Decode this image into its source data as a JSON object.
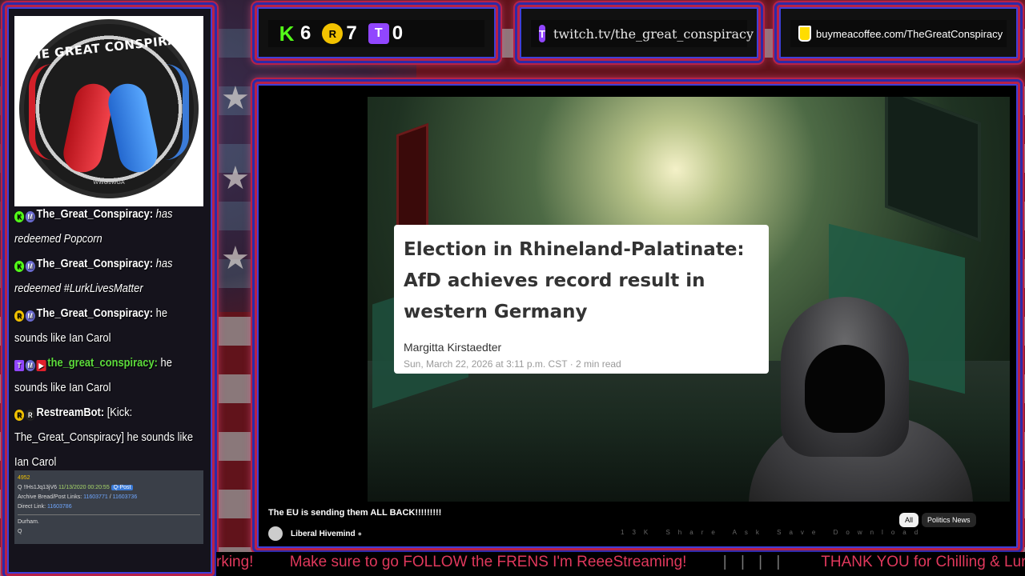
{
  "counts": [
    {
      "icon": "kick-icon",
      "glyph": "K",
      "value": "6"
    },
    {
      "icon": "rumble-icon",
      "glyph": "R",
      "value": "7"
    },
    {
      "icon": "twitch-icon",
      "glyph": "T",
      "value": "0"
    }
  ],
  "twitch_url": "twitch.tv/the_great_conspiracy",
  "bmac_url": "buymeacoffee.com/TheGreatConspiracy",
  "logo": {
    "title": "THE GREAT CONSPIRACY",
    "sub": "WWG1WGA"
  },
  "chat": [
    {
      "badges": [
        "kick",
        "mod"
      ],
      "name": "The_Great_Conspiracy:",
      "name_color": "white",
      "text": "has redeemed Popcorn",
      "italic": true
    },
    {
      "badges": [
        "kick",
        "mod"
      ],
      "name": "The_Great_Conspiracy:",
      "name_color": "white",
      "text": "has redeemed #LurkLivesMatter",
      "italic": true
    },
    {
      "badges": [
        "yellow",
        "mod"
      ],
      "name": "The_Great_Conspiracy:",
      "name_color": "white",
      "text": "he sounds like Ian Carol",
      "italic": false
    },
    {
      "badges": [
        "twitch",
        "mod",
        "red"
      ],
      "name": "the_great_conspiracy:",
      "name_color": "green",
      "text": "he sounds like Ian Carol",
      "italic": false
    },
    {
      "badges": [
        "yellow",
        "white"
      ],
      "name": "RestreamBot:",
      "name_color": "white",
      "text": "[Kick: The_Great_Conspiracy] he sounds like Ian Carol",
      "italic": false
    }
  ],
  "q_post": {
    "id": "4952",
    "line1_prefix": "Q",
    "trip": "!!Hs1Jq13jV6",
    "date": "11/13/2020 00:20:55",
    "tag": "Q-Post",
    "archive_label": "Archive Bread/Post Links:",
    "archive_link1": "11603771",
    "archive_sep": "/",
    "archive_link2": "11603736",
    "direct_label": "Direct Link:",
    "direct_link": "11603786",
    "body1": "Durham.",
    "body2": "Q"
  },
  "article": {
    "title": "Election in Rhineland-Palatinate: AfD achieves record result in western Germany",
    "author": "Margitta Kirstaedter",
    "date": "Sun, March 22, 2026 at 3:11 p.m. CST",
    "read_time": "2 min read"
  },
  "video": {
    "title": "The EU is sending them ALL BACK!!!!!!!!!",
    "channel": "Liberal Hivemind",
    "chip_all": "All",
    "chip_topic": "Politics News",
    "actions": "13K Share Ask Save Download"
  },
  "ticker": {
    "items": [
      "rking!",
      "Make sure to go FOLLOW the FRENS I'm ReeeStreaming!",
      "THANK YOU for Chilling & Lur"
    ],
    "separator": "| | | |"
  }
}
